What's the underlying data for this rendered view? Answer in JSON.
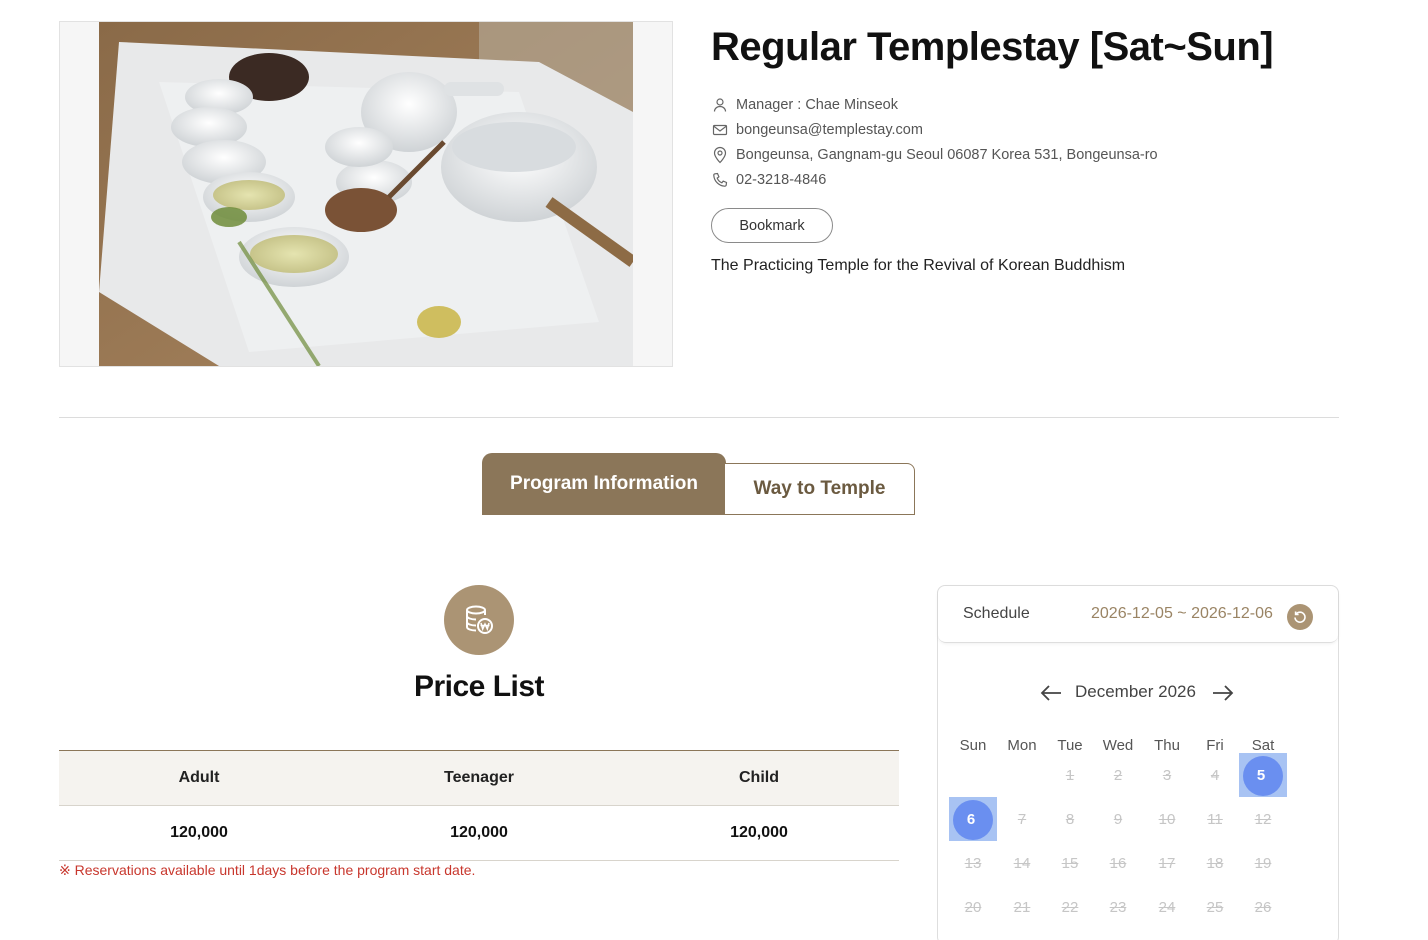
{
  "program": {
    "title": "Regular Templestay [Sat~Sun]",
    "manager": "Manager : Chae Minseok",
    "email": "bongeunsa@templestay.com",
    "address": "Bongeunsa, Gangnam-gu Seoul 06087 Korea 531, Bongeunsa-ro",
    "phone": "02-3218-4846",
    "bookmark_label": "Bookmark",
    "slogan": "The Practicing Temple for the Revival of Korean Buddhism"
  },
  "tabs": [
    {
      "label": "Program Information",
      "active": true
    },
    {
      "label": "Way to Temple",
      "active": false
    }
  ],
  "price": {
    "title": "Price List",
    "headers": [
      "Adult",
      "Teenager",
      "Child"
    ],
    "values": [
      "120,000",
      "120,000",
      "120,000"
    ],
    "notice": "※ Reservations available until 1days before the program start date."
  },
  "schedule": {
    "label": "Schedule",
    "range": "2026-12-05 ~ 2026-12-06",
    "month": "December 2026",
    "weekdays": [
      "Sun",
      "Mon",
      "Tue",
      "Wed",
      "Thu",
      "Fri",
      "Sat"
    ],
    "weeks": [
      [
        "",
        "",
        "1",
        "2",
        "3",
        "4",
        "5"
      ],
      [
        "6",
        "7",
        "8",
        "9",
        "10",
        "11",
        "12"
      ],
      [
        "13",
        "14",
        "15",
        "16",
        "17",
        "18",
        "19"
      ],
      [
        "20",
        "21",
        "22",
        "23",
        "24",
        "25",
        "26"
      ]
    ],
    "selected": [
      "5",
      "6"
    ]
  },
  "colors": {
    "accent": "#8b7659",
    "accent_light": "#ab9474",
    "selected_day": "#6a8ff0",
    "notice": "#c8372d"
  },
  "icons": {
    "manager": "person-icon",
    "email": "mail-icon",
    "address": "location-pin-icon",
    "phone": "phone-icon",
    "price": "coins-won-icon",
    "reset": "refresh-icon",
    "prev": "arrow-left-icon",
    "next": "arrow-right-icon"
  }
}
